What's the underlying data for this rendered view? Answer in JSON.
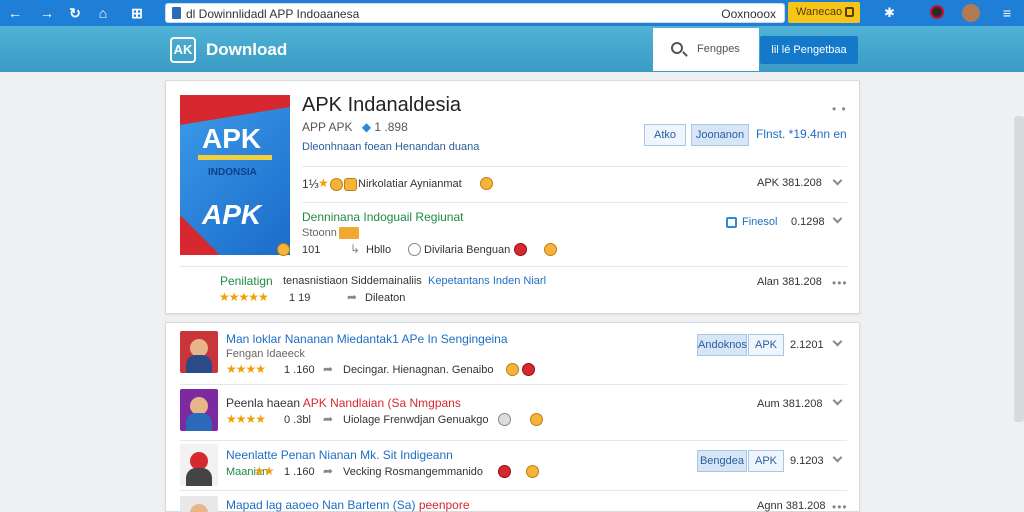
{
  "browser": {
    "url": "dl Dowinnlidadl APP Indoaanesa",
    "address_right": "Ooxnooox",
    "button_label": "Wanecao"
  },
  "header": {
    "logo_mark": "AK",
    "logo_text": "Download",
    "search_label": "Fengpes",
    "action_button": "lil lé Pengetbaa"
  },
  "app": {
    "icon_top": "APK",
    "icon_middle": "INDONSIA",
    "icon_bottom": "APK",
    "title": "APK Indanaldesia",
    "subtitle": "APP APK",
    "subtitle_version": "1 .898",
    "description": "Dleonhnaan foean Henandan duana",
    "chip1": "Atko",
    "chip2": "Joonanon",
    "price": "Flnst. *19.4nn en",
    "row1_rank": "1⅓",
    "row1_text": "Nirkolatiar Aynianmat",
    "row1_right": "APK 381.208",
    "row2_title": "Denninana Indoguail Regiunat",
    "row2_right_label": "Finesol",
    "row2_right_value": "0.1298",
    "row3_label": "Stoonn",
    "row3_count": "101",
    "row3_sort": "Hbllo",
    "row3_text": "Divilaria Benguan",
    "bottom_green": "Penilatign",
    "bottom_text": "tenasnistiaon Siddemainaliis",
    "bottom_blue": "Kepetantans Inden Niarl",
    "bottom_rating": "1 19",
    "bottom_link": "Dileaton",
    "bottom_right": "Alan 381.208"
  },
  "list": [
    {
      "title": "Man loklar Nananan  Miedantak1 APe In Sengingeina",
      "subtitle": "Fengan Idaeeck",
      "rating": "1 .160",
      "action": "Decingar. Hienagnan. Genaibo",
      "chip1": "Andoknos",
      "chip2": "APK",
      "right": "2.1201"
    },
    {
      "title": "Peenla haean",
      "title_red": "APK  Nandlaian (Sa Nmgpans",
      "rating": "0 .3bl",
      "action": "Uiolage  Frenwdjan Genuakgo",
      "right": "Aum 381.208"
    },
    {
      "title": "Neenlatte Penan Nianan Mk. Sit Indigeann",
      "green": "Maanian",
      "rating": "1 .160",
      "action": "Vecking  Rosmangemmanido",
      "chip1": "Bengdea",
      "chip2": "APK",
      "right": "9.1203"
    },
    {
      "title": "Mapad lag aaoeo Nan Bartenn (Sa)",
      "title_red": "peenpore",
      "right": "Agnn 381.208"
    }
  ],
  "colors": {
    "browser_bar": "#1f7fd6",
    "header": "#3a9bc4",
    "accent": "#1479c9",
    "stars": "#f0a000",
    "brand_red": "#d7282f"
  }
}
